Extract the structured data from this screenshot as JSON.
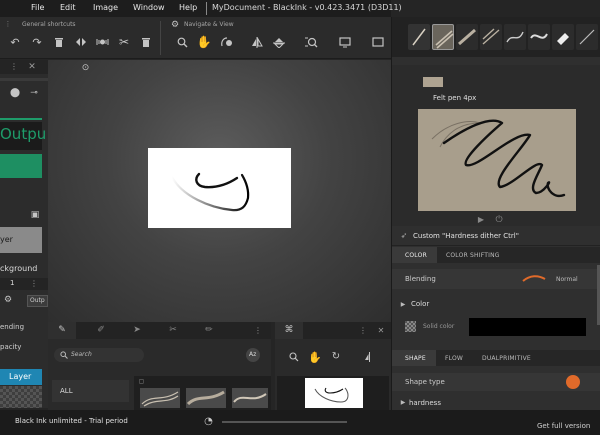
{
  "menubar": {
    "items": [
      "File",
      "Edit",
      "Image",
      "Window",
      "Help"
    ],
    "title": "MyDocument - BlackInk - v0.423.3471 (D3D11)"
  },
  "toolbar": {
    "general_label": "General shortcuts",
    "navigate_label": "Navigate & View"
  },
  "left_dock": {
    "output_label": "Outpu",
    "layer_button_label": "yer",
    "background_label": "ckground",
    "tab_number": "1",
    "output_tab": "Outp",
    "blending_label": "ending",
    "opacity_label": "pacity",
    "layer_label": "Layer"
  },
  "brush_library": {
    "search_placeholder": "Search",
    "sort_label": "Az",
    "category_all": "ALL"
  },
  "right_panel": {
    "brush_name": "Felt pen 4px",
    "custom_label": "Custom \"Hardness dither Ctrl\"",
    "color_tabs": [
      "COLOR",
      "COLOR SHIFTING"
    ],
    "blending_label": "Blending",
    "blending_value": "Normal",
    "color_section": "Color",
    "solid_color_label": "Solid color",
    "shape_tabs": [
      "SHAPE",
      "FLOW",
      "DUALPRIMITIVE"
    ],
    "shape_type_label": "Shape type",
    "hardness_label": "hardness"
  },
  "status": {
    "text": "Black Ink unlimited - Trial period",
    "get_full": "Get full version"
  },
  "colors": {
    "accent_green": "#1e9c6a",
    "accent_orange": "#e06a2a",
    "layer_blue": "#1f86b3"
  }
}
